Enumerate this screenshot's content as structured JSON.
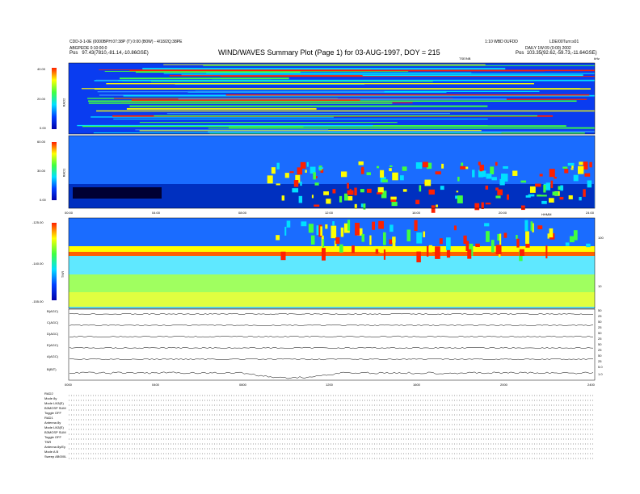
{
  "header": {
    "left_line1": "CDD-3-1-0E (0000BPH:07:38P (T) 0:00 (B0W) - 4/18/2Q:38PE",
    "left_line2": "ABGPEDE 0:10:00:0",
    "left_pos_label": "Pos",
    "left_pos_value": "97.43(7810,-81.14,-10.86GSE)",
    "title": "WIND/WAVES Summary Plot (Page 1) for 03-AUG-1997, DOY = 215",
    "right_line1": "1:10 WBD 0UFDD",
    "right_line2": "DAILY 1W:09 (0:00) 2002",
    "right_pos_label": "Pos",
    "right_pos_value": "103.35(92.62,-59.73,-11.64GSE)",
    "right_corner": "LDE/00Turn:s01",
    "sub_right": "TSE/NB",
    "sub_right2": "kHz"
  },
  "chart_data": [
    {
      "type": "heatmap",
      "panel": "RAD2",
      "ylabel": "RAD2",
      "yticks": [
        "0.00",
        "20.00",
        "40.00"
      ],
      "description_colors": "blue background with horizontal red/yellow bands"
    },
    {
      "type": "heatmap",
      "panel": "RAD1",
      "ylabel": "RAD1",
      "yticks": [
        "0.00",
        "30.00",
        "60.00"
      ],
      "xticks": [
        "00:00",
        "04:00",
        "08:00",
        "12:00",
        "16:00",
        "20:00",
        "24:00"
      ],
      "xlabel_right": "HHMM"
    },
    {
      "type": "heatmap",
      "panel": "TNR",
      "ylabel": "TNR",
      "yticks": [
        "-125.00",
        "-140.00",
        "-155.00"
      ],
      "right_ticks": [
        "100",
        "10"
      ]
    },
    {
      "type": "line",
      "panel": "SWE",
      "rows": [
        {
          "label": "B(AGC)",
          "right_ticks": [
            "25",
            "50"
          ]
        },
        {
          "label": "C(AGC)",
          "right_ticks": [
            "25",
            "50"
          ]
        },
        {
          "label": "D(AGC)",
          "right_ticks": [
            "25",
            "50"
          ]
        },
        {
          "label": "E(AGC)",
          "right_ticks": [
            "25",
            "50"
          ]
        },
        {
          "label": "A(AGC)",
          "right_ticks": [
            "25",
            "50"
          ]
        },
        {
          "label": "B(BIT)",
          "right_ticks": [
            "5.0",
            "1.0"
          ]
        }
      ],
      "xticks": [
        "0000",
        "0400",
        "0800",
        "1200",
        "1600",
        "2000",
        "2400"
      ]
    }
  ],
  "footer": [
    "RAD2",
    "Mode 8y",
    "Mode LN3(E)",
    "B3MOSP SUM",
    "Toggle OFF",
    "RAD1",
    "Antenna 8y",
    "Mode LN3(E)",
    "B3MOSP SUM",
    "Toggle OFF",
    "TNR",
    "Antenna 8y/Ey",
    "Mode A B",
    "Sweep AB000L"
  ]
}
